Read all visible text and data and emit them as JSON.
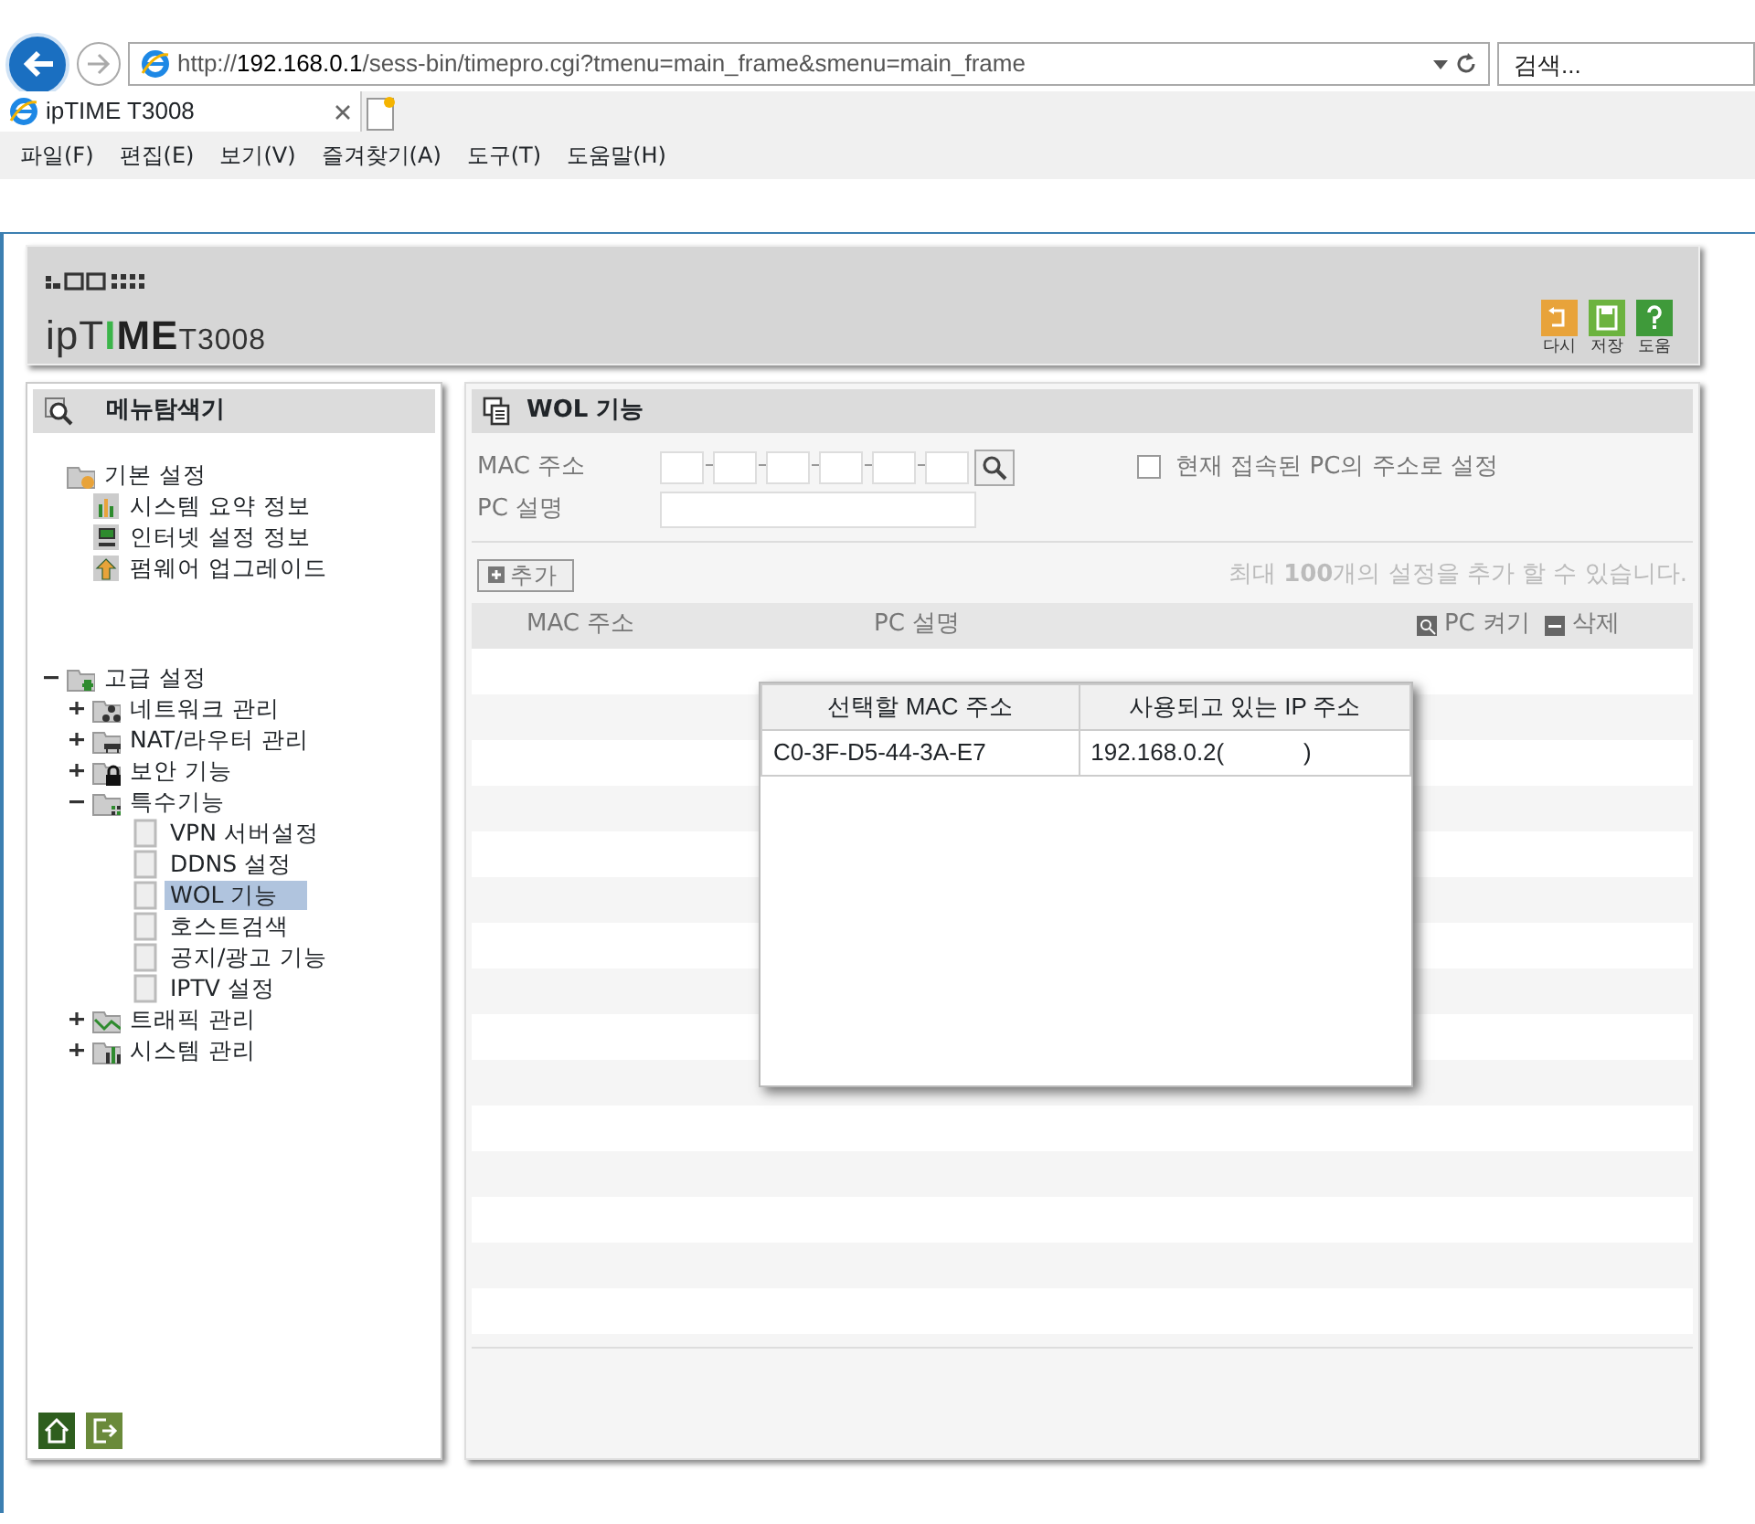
{
  "browser": {
    "url_prefix": "http://",
    "url_host": "192.168.0.1",
    "url_path": "/sess-bin/timepro.cgi?tmenu=main_frame&smenu=main_frame",
    "search": {
      "placeholder": "검색..."
    },
    "tabs": [
      {
        "label": "ipTIME T3008",
        "selected": true
      }
    ],
    "menu": [
      {
        "label": "파일(F)"
      },
      {
        "label": "편집(E)"
      },
      {
        "label": "보기(V)"
      },
      {
        "label": "즐겨찾기(A)"
      },
      {
        "label": "도구(T)"
      },
      {
        "label": "도움말(H)"
      }
    ]
  },
  "header": {
    "brand_parts": [
      {
        "text": "ipT",
        "accent": false
      },
      {
        "text": "I",
        "accent": true
      },
      {
        "text": "ME",
        "accent": false
      }
    ],
    "model": "T3008",
    "actions": [
      {
        "kind": "undo",
        "label": "다시"
      },
      {
        "kind": "save",
        "label": "저장"
      },
      {
        "kind": "help",
        "label": "도움"
      }
    ]
  },
  "sidebar": {
    "title": "메뉴탐색기",
    "tree": [
      {
        "label": "기본 설정",
        "kind": "basic",
        "children": [
          {
            "label": "시스템 요약 정보",
            "kind": "chart"
          },
          {
            "label": "인터넷 설정 정보",
            "kind": "monitor"
          },
          {
            "label": "펌웨어 업그레이드",
            "kind": "upload"
          }
        ]
      },
      {
        "label": "고급 설정",
        "kind": "advanced",
        "expanded": true,
        "children": [
          {
            "label": "네트워크 관리",
            "kind": "network",
            "expanded": false
          },
          {
            "label": "NAT/라우터 관리",
            "kind": "nat",
            "expanded": false
          },
          {
            "label": "보안 기능",
            "kind": "lock",
            "expanded": false
          },
          {
            "label": "특수기능",
            "kind": "special",
            "expanded": true,
            "children": [
              {
                "label": "VPN 서버설정",
                "kind": "page",
                "selected": false
              },
              {
                "label": "DDNS 설정",
                "kind": "page",
                "selected": false
              },
              {
                "label": "WOL 기능",
                "kind": "page",
                "selected": true
              },
              {
                "label": "호스트검색",
                "kind": "page",
                "selected": false
              },
              {
                "label": "공지/광고 기능",
                "kind": "page",
                "selected": false
              },
              {
                "label": "IPTV 설정",
                "kind": "page",
                "selected": false
              }
            ]
          },
          {
            "label": "트래픽 관리",
            "kind": "traffic",
            "expanded": false
          },
          {
            "label": "시스템 관리",
            "kind": "system",
            "expanded": false
          }
        ]
      }
    ]
  },
  "panel": {
    "title": "WOL 기능",
    "mac_label": "MAC 주소",
    "pc_label": "PC 설명",
    "use_current": {
      "label": "현재 접속된 PC의 주소로 설정",
      "checked": false
    },
    "add_button": "추가",
    "limit_note": "최대 **100**개의 설정을 추가 할 수 있습니다.",
    "columns": [
      "MAC 주소",
      "PC 설명"
    ],
    "wake_label": "PC 켜기",
    "delete_label": "삭제"
  },
  "popup": {
    "columns": [
      "선택할 MAC 주소",
      "사용되고 있는 IP 주소"
    ],
    "rows": [
      [
        "C0-3F-D5-44-3A-E7",
        "192.168.0.2(            )"
      ]
    ]
  }
}
